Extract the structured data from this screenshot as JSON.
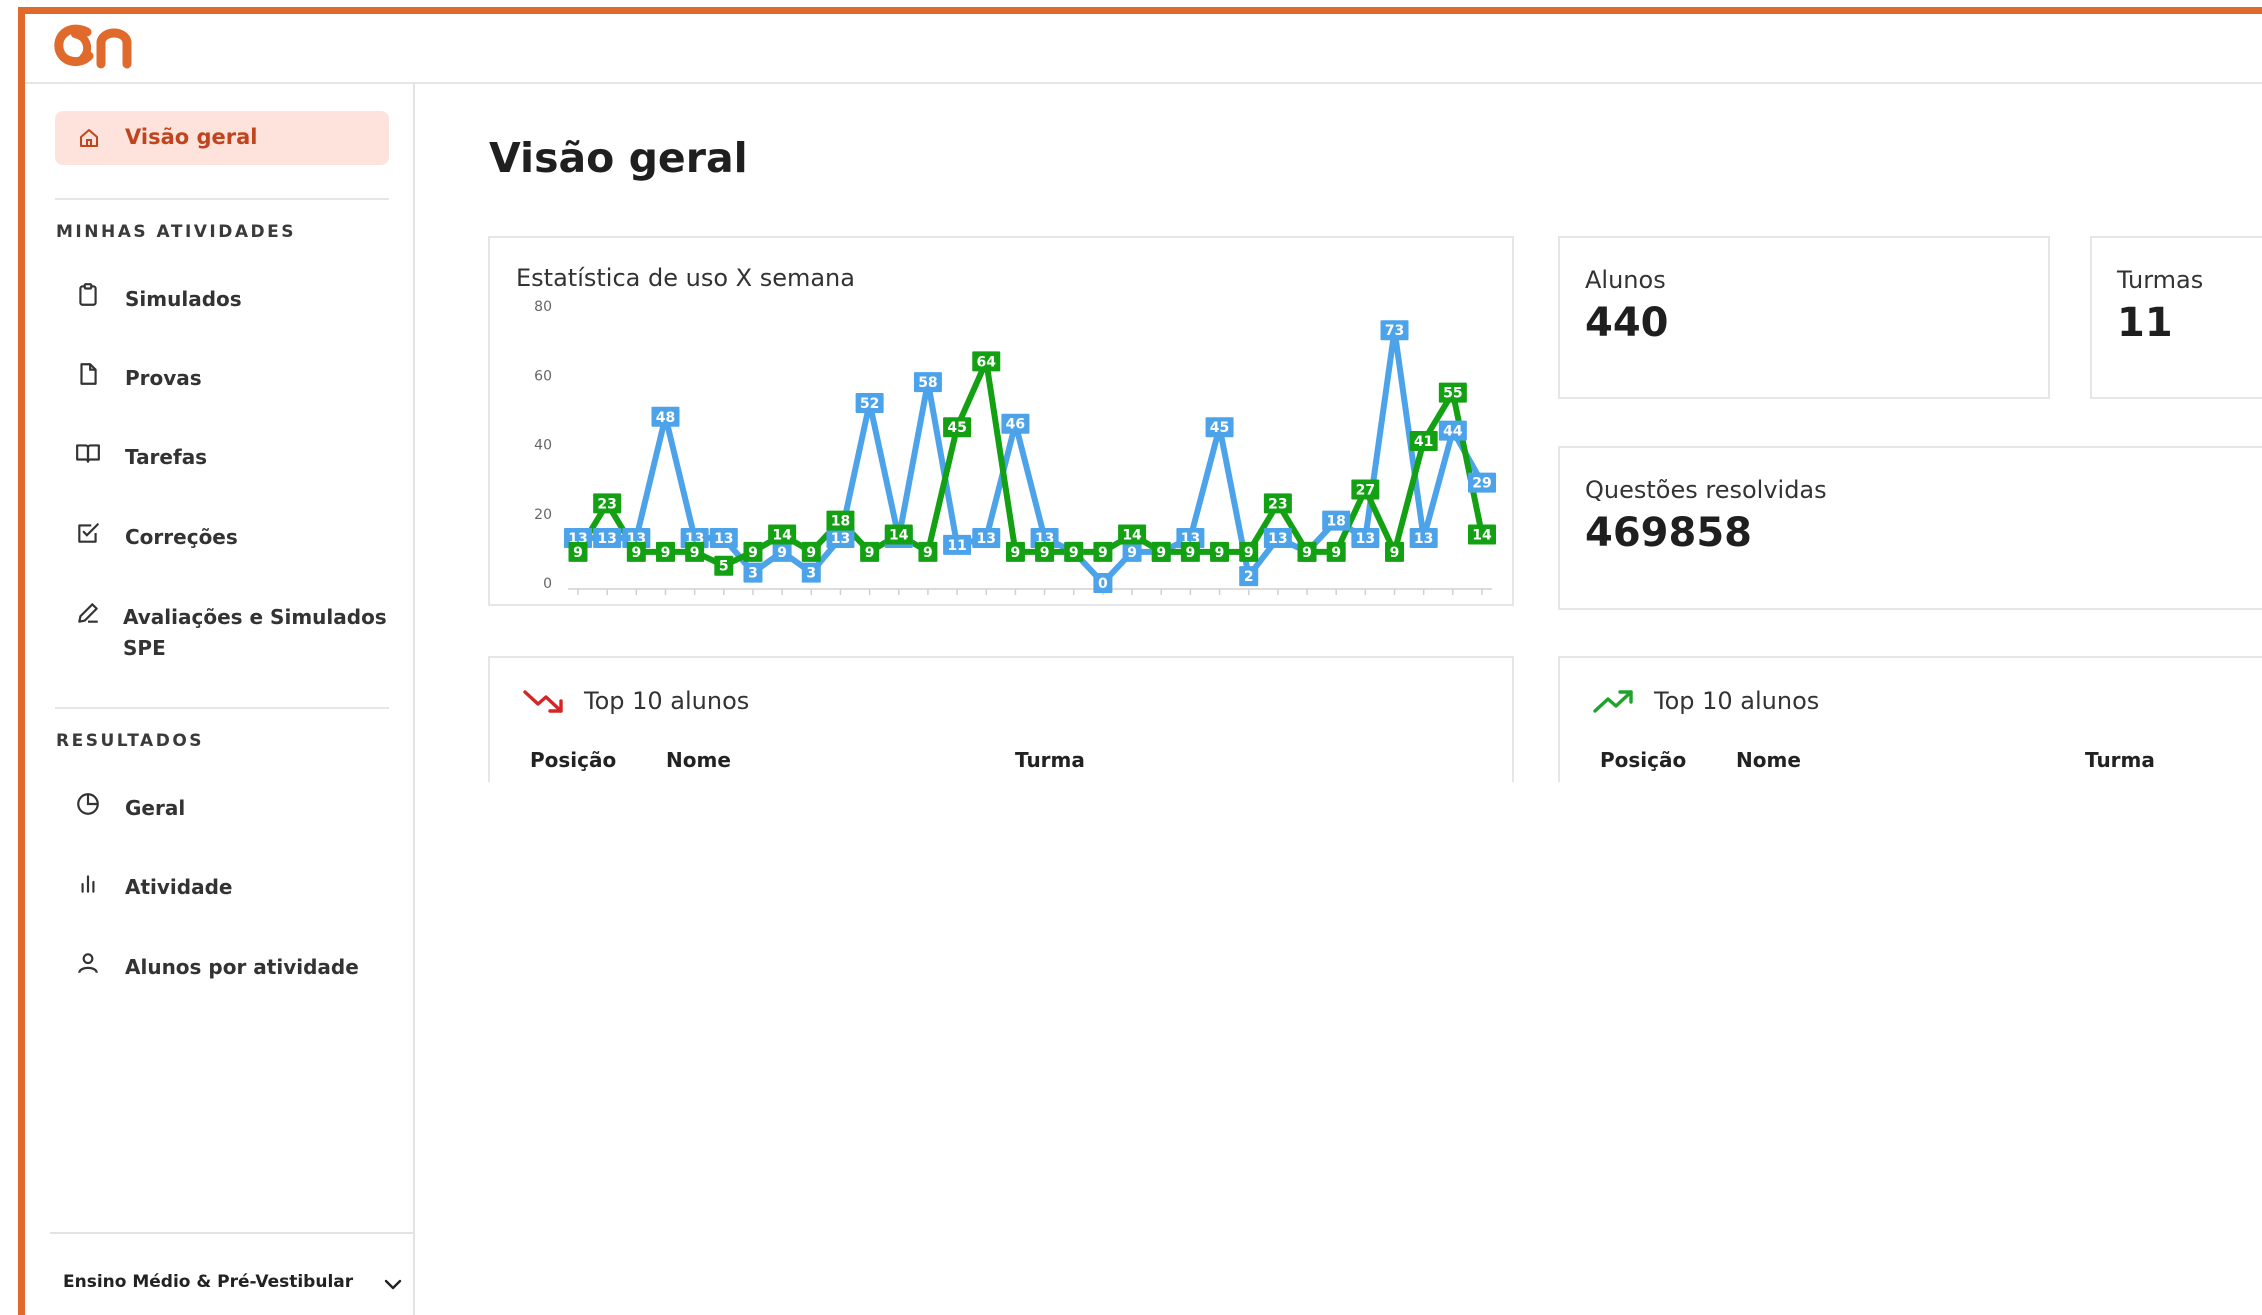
{
  "colors": {
    "accent": "#e0692c",
    "active_bg": "#fde3dc",
    "active_text": "#c0451e",
    "series_blue": "#4da3ea",
    "series_green": "#13a113",
    "trend_down": "#d62525",
    "trend_up": "#1ea32c"
  },
  "header": {
    "logo_icon": "on-logo"
  },
  "sidebar": {
    "active_item": {
      "label": "Visão geral",
      "icon": "home-icon"
    },
    "sections": [
      {
        "title": "MINHAS ATIVIDADES"
      },
      {
        "title": "RESULTADOS"
      }
    ],
    "items": [
      {
        "label": "Simulados",
        "icon": "clipboard-icon"
      },
      {
        "label": "Provas",
        "icon": "file-icon"
      },
      {
        "label": "Tarefas",
        "icon": "book-icon"
      },
      {
        "label": "Correções",
        "icon": "checkbox-icon"
      },
      {
        "label_line1": "Avaliações e Simulados",
        "label_line2": "SPE",
        "icon": "pencil-icon"
      },
      {
        "label": "Geral",
        "icon": "pie-chart-icon"
      },
      {
        "label": "Atividade",
        "icon": "bar-chart-icon"
      },
      {
        "label": "Alunos por atividade",
        "icon": "user-icon"
      }
    ],
    "footer": {
      "level_select": "Ensino Médio & Pré-Vestibular",
      "icon": "chevron-down-icon"
    }
  },
  "main": {
    "title": "Visão geral",
    "stats": [
      {
        "label": "Alunos",
        "value": "440"
      },
      {
        "label": "Turmas",
        "value": "11"
      },
      {
        "label": "Questões resolvidas",
        "value": "469858"
      }
    ],
    "top_tables": [
      {
        "title": "Top 10 alunos",
        "icon": "trending-down-icon",
        "columns": [
          "Posição",
          "Nome",
          "Turma"
        ]
      },
      {
        "title": "Top 10 alunos",
        "icon": "trending-up-icon",
        "columns": [
          "Posição",
          "Nome",
          "Turma"
        ]
      }
    ]
  },
  "chart_data": {
    "type": "line",
    "title": "Estatística de uso X semana",
    "xlabel": "",
    "ylabel": "",
    "ylim": [
      0,
      80
    ],
    "yticks": [
      0,
      20,
      40,
      60,
      80
    ],
    "x": [
      1,
      2,
      3,
      4,
      5,
      6,
      7,
      8,
      9,
      10,
      11,
      12,
      13,
      14,
      15,
      16,
      17,
      18,
      19,
      20,
      21,
      22,
      23,
      24,
      25,
      26,
      27,
      28,
      29,
      30,
      31,
      32
    ],
    "grid": false,
    "legend": "none",
    "series": [
      {
        "color": "#4da3ea",
        "values": [
          13,
          13,
          13,
          48,
          13,
          13,
          3,
          9,
          3,
          13,
          52,
          13,
          58,
          11,
          13,
          46,
          13,
          9,
          0,
          9,
          9,
          13,
          45,
          2,
          13,
          9,
          18,
          13,
          73,
          13,
          44,
          29
        ]
      },
      {
        "color": "#13a113",
        "values": [
          9,
          23,
          9,
          9,
          9,
          5,
          9,
          14,
          9,
          18,
          9,
          14,
          9,
          45,
          64,
          9,
          9,
          9,
          9,
          14,
          9,
          9,
          9,
          9,
          23,
          9,
          9,
          27,
          9,
          41,
          55,
          14
        ]
      }
    ]
  }
}
